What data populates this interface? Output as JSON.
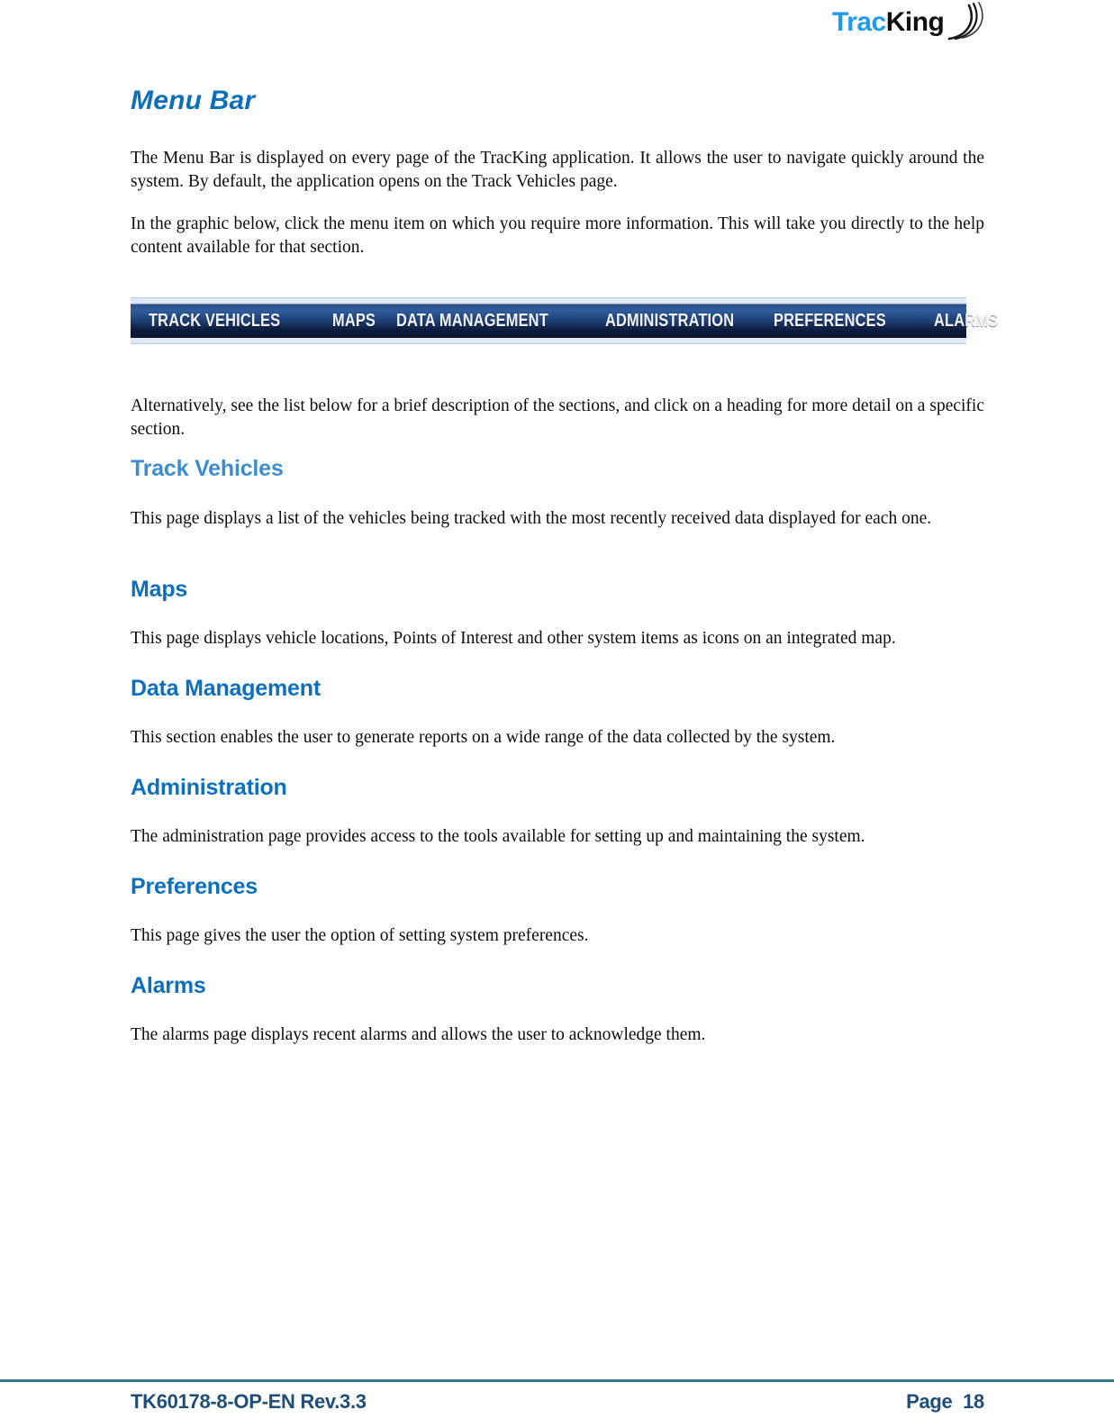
{
  "header": {
    "logo": {
      "text_primary": "Trac",
      "text_secondary": "King",
      "icon": "signal-wave-icon",
      "primary_color": "#1E9BEF",
      "secondary_color": "#111111"
    }
  },
  "document": {
    "title": "Menu Bar",
    "title_color": "#0C6FBC",
    "intro_paragraph_1": "The Menu Bar is displayed on every page of the TracKing application. It allows the user to navigate quickly around the system. By default, the application opens on the Track Vehicles page.",
    "intro_paragraph_2": "In the graphic below, click the menu item on which you require more information. This will take you directly to the help content available for that section.",
    "after_graphic_paragraph": "Alternatively, see the list below for a brief description of the sections, and click on a heading for more detail on a specific section.",
    "heading_color": "#0C70BC"
  },
  "menu_bar_graphic": {
    "items": [
      {
        "label": "TRACK VEHICLES"
      },
      {
        "label": "MAPS"
      },
      {
        "label": "DATA MANAGEMENT"
      },
      {
        "label": "ADMINISTRATION"
      },
      {
        "label": "PREFERENCES"
      },
      {
        "label": "ALARMS"
      }
    ],
    "bar_color_top": "#2F5C9C",
    "bar_color_bottom": "#0A1631",
    "frame_color": "#DFE6F4",
    "text_color": "#F2F4F8"
  },
  "sections": [
    {
      "heading": "Track Vehicles",
      "body": "This page displays a list of the vehicles being tracked with the most recently received data displayed for each one."
    },
    {
      "heading": "Maps",
      "body": "This page displays vehicle locations, Points of Interest and other system items as icons on an integrated map."
    },
    {
      "heading": "Data Management",
      "body": "This section enables the user to generate reports on a wide range of the data collected by the system."
    },
    {
      "heading": "Administration",
      "body": "The administration page provides access to the tools available for setting up and maintaining the system."
    },
    {
      "heading": "Preferences",
      "body": "This page gives the user the option of setting system preferences."
    },
    {
      "heading": "Alarms",
      "body": "The alarms page displays recent alarms and allows the user to acknowledge them."
    }
  ],
  "footer": {
    "document_code": "TK60178-8-OP-EN Rev.3.3",
    "page_label": "Page  18",
    "rule_color": "#35788C",
    "text_color": "#1F4E79"
  }
}
